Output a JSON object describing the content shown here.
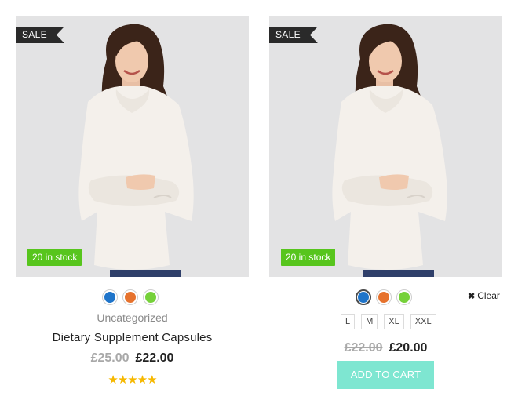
{
  "products": [
    {
      "badge": "SALE",
      "stock": "20 in stock",
      "swatches": [
        {
          "name": "blue",
          "color": "#1f74c9"
        },
        {
          "name": "orange",
          "color": "#e6722d"
        },
        {
          "name": "green",
          "color": "#76d13a"
        }
      ],
      "category": "Uncategorized",
      "title": "Dietary Supplement Capsules",
      "old_price": "£25.00",
      "price": "£22.00",
      "rating": "★★★★★"
    },
    {
      "badge": "SALE",
      "stock": "20 in stock",
      "swatches": [
        {
          "name": "blue",
          "color": "#1f74c9",
          "selected": true
        },
        {
          "name": "orange",
          "color": "#e6722d"
        },
        {
          "name": "green",
          "color": "#76d13a"
        }
      ],
      "sizes": [
        "L",
        "M",
        "XL",
        "XXL"
      ],
      "clear_label": "Clear",
      "old_price": "£22.00",
      "price": "£20.00",
      "add_to_cart_label": "ADD TO CART"
    }
  ],
  "colors": {
    "sale_badge": "#2a2a2a",
    "stock_badge": "#57c51d",
    "add_to_cart": "#7ee6d1",
    "star": "#f6b800"
  }
}
